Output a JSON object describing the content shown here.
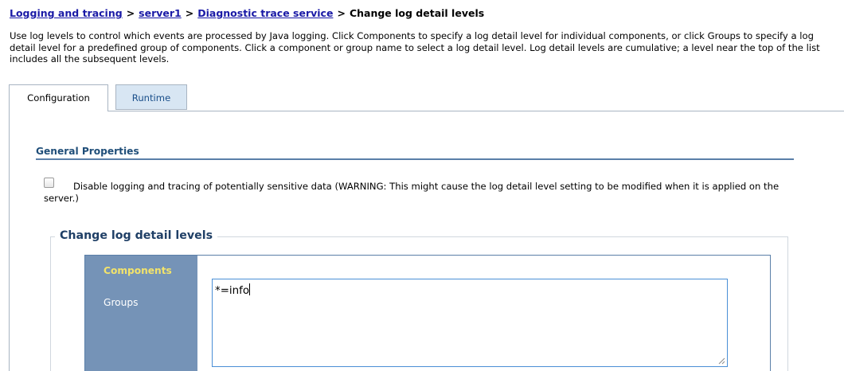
{
  "breadcrumb": {
    "items": [
      "Logging and tracing",
      "server1",
      "Diagnostic trace service"
    ],
    "separator": ">",
    "current": "Change log detail levels"
  },
  "intro_text": "Use log levels to control which events are processed by Java logging. Click Components to specify a log detail level for individual components, or click Groups to specify a log detail level for a predefined group of components. Click a component or group name to select a log detail level. Log detail levels are cumulative; a level near the top of the list includes all the subsequent levels.",
  "tabs": [
    {
      "label": "Configuration",
      "active": true
    },
    {
      "label": "Runtime",
      "active": false
    }
  ],
  "general_properties": {
    "title": "General Properties",
    "checkbox": {
      "checked": false,
      "label": "Disable logging and tracing of potentially sensitive data (WARNING: This might cause the log detail level setting to be modified when it is applied on the server.)"
    }
  },
  "log_levels": {
    "legend": "Change log detail levels",
    "nav": [
      {
        "label": "Components",
        "selected": true
      },
      {
        "label": "Groups",
        "selected": false
      }
    ],
    "textarea_value": "*=info"
  },
  "colors": {
    "link": "#1a1aa6",
    "nav_background": "#7593b7",
    "nav_selected_text": "#f2e36b",
    "section_title": "#1f4e79",
    "runtime_tab_bg": "#d8e6f3"
  }
}
